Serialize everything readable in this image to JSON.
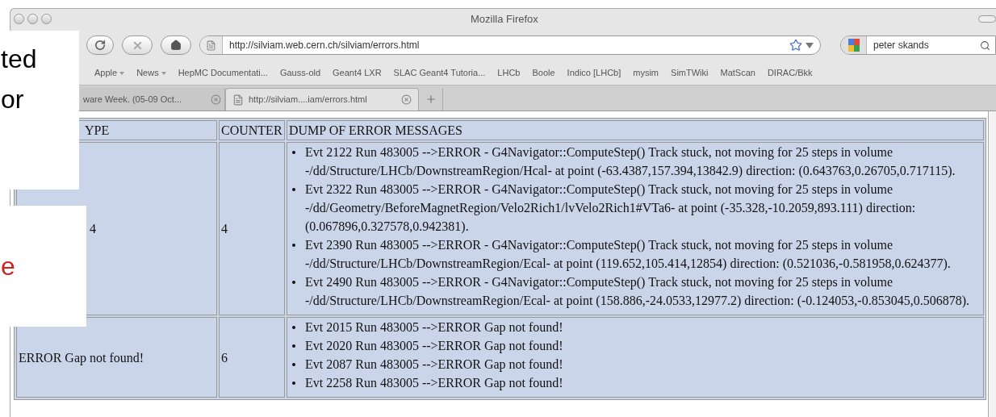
{
  "window": {
    "title": "Mozilla Firefox"
  },
  "toolbar": {
    "url": "http://silviam.web.cern.ch/silviam/errors.html",
    "search_value": "peter skands"
  },
  "bookmarks": [
    {
      "label": "Apple",
      "menu": true
    },
    {
      "label": "News",
      "menu": true
    },
    {
      "label": "HepMC Documentati...",
      "menu": false
    },
    {
      "label": "Gauss-old",
      "menu": false
    },
    {
      "label": "Geant4 LXR",
      "menu": false
    },
    {
      "label": "SLAC Geant4 Tutoria...",
      "menu": false
    },
    {
      "label": "LHCb",
      "menu": false
    },
    {
      "label": "Boole",
      "menu": false
    },
    {
      "label": "Indico [LHCb]",
      "menu": false
    },
    {
      "label": "mysim",
      "menu": false
    },
    {
      "label": "SimTWiki",
      "menu": false
    },
    {
      "label": "MatScan",
      "menu": false
    },
    {
      "label": "DIRAC/Bkk",
      "menu": false
    }
  ],
  "tabs": [
    {
      "label": "ware Week. (05-09 Oct...",
      "selected": false,
      "page_icon": false
    },
    {
      "label": "http://silviam....iam/errors.html",
      "selected": true,
      "page_icon": true
    }
  ],
  "table": {
    "columns": [
      "YPE",
      "COUNTER",
      "DUMP OF ERROR MESSAGES"
    ],
    "rows": [
      {
        "type": "4",
        "counter": "4",
        "messages": [
          "Evt 2122 Run 483005 -->ERROR - G4Navigator::ComputeStep() Track stuck, not moving for 25 steps in volume -/dd/Structure/LHCb/DownstreamRegion/Hcal- at point (-63.4387,157.394,13842.9) direction: (0.643763,0.26705,0.717115).",
          "Evt 2322 Run 483005 -->ERROR - G4Navigator::ComputeStep() Track stuck, not moving for 25 steps in volume -/dd/Geometry/BeforeMagnetRegion/Velo2Rich1/lvVelo2Rich1#VTa6- at point (-35.328,-10.2059,893.111) direction: (0.067896,0.327578,0.942381).",
          "Evt 2390 Run 483005 -->ERROR - G4Navigator::ComputeStep() Track stuck, not moving for 25 steps in volume -/dd/Structure/LHCb/DownstreamRegion/Ecal- at point (119.652,105.414,12854) direction: (0.521036,-0.581958,0.624377).",
          "Evt 2490 Run 483005 -->ERROR - G4Navigator::ComputeStep() Track stuck, not moving for 25 steps in volume -/dd/Structure/LHCb/DownstreamRegion/Ecal- at point (158.886,-24.0533,12977.2) direction: (-0.124053,-0.853045,0.506878)."
        ]
      },
      {
        "type": "ERROR Gap not found!",
        "counter": "6",
        "messages": [
          "Evt 2015 Run 483005 -->ERROR Gap not found!",
          "Evt 2020 Run 483005 -->ERROR Gap not found!",
          "Evt 2087 Run 483005 -->ERROR Gap not found!",
          "Evt 2258 Run 483005 -->ERROR Gap not found!"
        ]
      }
    ]
  },
  "slide_overlays": [
    {
      "lines": [
        "ted",
        "or"
      ],
      "kind": "plain"
    },
    {
      "lines": [
        "e"
      ],
      "kind": "accent"
    }
  ]
}
